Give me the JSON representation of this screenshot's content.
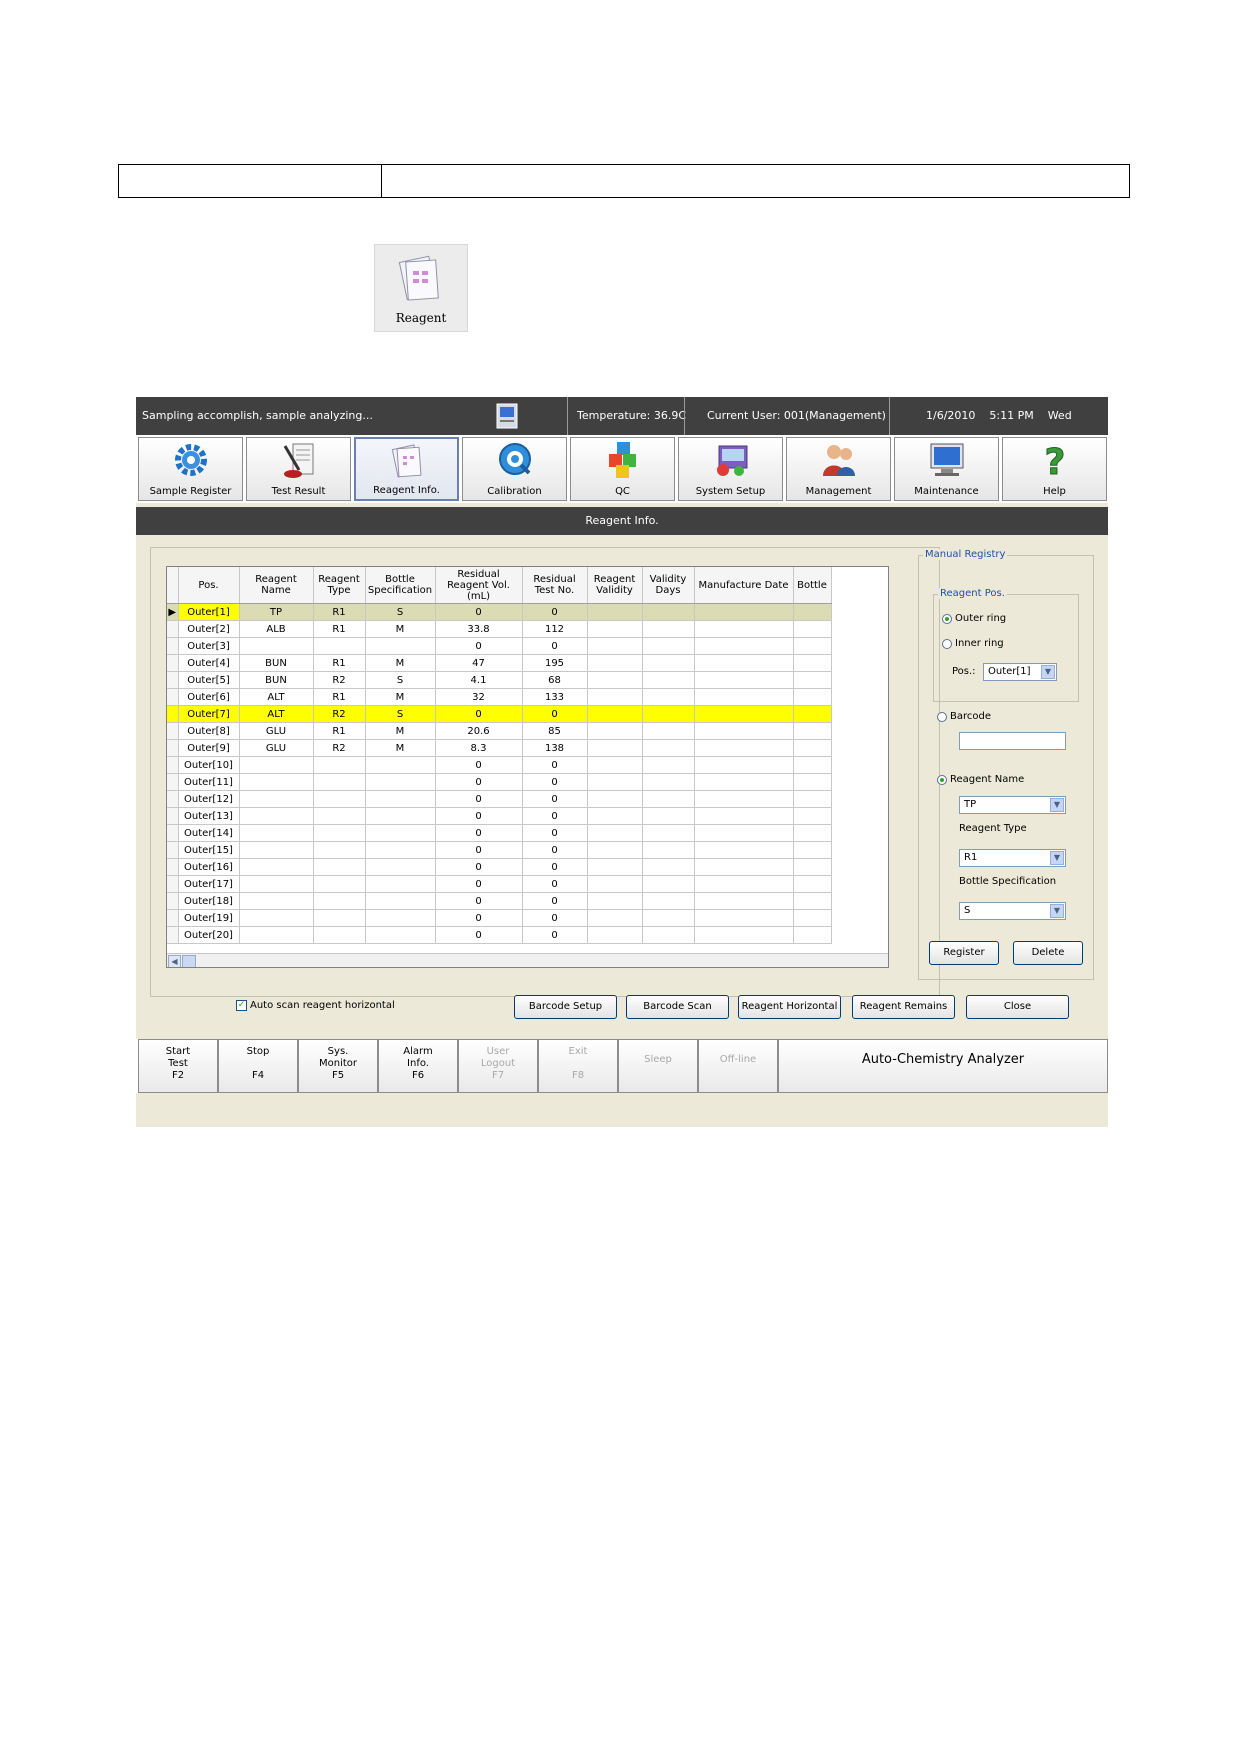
{
  "reagent_icon_label": "Reagent",
  "status": {
    "message": "Sampling accomplish, sample analyzing...",
    "temperature": "Temperature:  36.9C",
    "current_user": "Current User:  001(Management)",
    "datetime": "1/6/2010    5:11 PM    Wed"
  },
  "nav": [
    {
      "label": "Sample Register",
      "icon": "gear-icon"
    },
    {
      "label": "Test Result",
      "icon": "test-result-icon"
    },
    {
      "label": "Reagent Info.",
      "icon": "reagent-icon"
    },
    {
      "label": "Calibration",
      "icon": "calibration-icon"
    },
    {
      "label": "QC",
      "icon": "qc-cubes-icon"
    },
    {
      "label": "System Setup",
      "icon": "system-setup-icon"
    },
    {
      "label": "Management",
      "icon": "management-users-icon"
    },
    {
      "label": "Maintenance",
      "icon": "monitor-icon"
    },
    {
      "label": "Help",
      "icon": "help-question-icon"
    }
  ],
  "page_title": "Reagent Info.",
  "table": {
    "headers": [
      "Pos.",
      "Reagent Name",
      "Reagent Type",
      "Bottle Specification",
      "Residual Reagent Vol.(mL)",
      "Residual Test No.",
      "Reagent Validity",
      "Validity Days",
      "Manufacture Date",
      "Bottle"
    ],
    "rows": [
      [
        "Outer[1]",
        "TP",
        "R1",
        "S",
        "0",
        "0",
        "",
        "",
        "",
        ""
      ],
      [
        "Outer[2]",
        "ALB",
        "R1",
        "M",
        "33.8",
        "112",
        "",
        "",
        "",
        ""
      ],
      [
        "Outer[3]",
        "",
        "",
        "",
        "0",
        "0",
        "",
        "",
        "",
        ""
      ],
      [
        "Outer[4]",
        "BUN",
        "R1",
        "M",
        "47",
        "195",
        "",
        "",
        "",
        ""
      ],
      [
        "Outer[5]",
        "BUN",
        "R2",
        "S",
        "4.1",
        "68",
        "",
        "",
        "",
        ""
      ],
      [
        "Outer[6]",
        "ALT",
        "R1",
        "M",
        "32",
        "133",
        "",
        "",
        "",
        ""
      ],
      [
        "Outer[7]",
        "ALT",
        "R2",
        "S",
        "0",
        "0",
        "",
        "",
        "",
        ""
      ],
      [
        "Outer[8]",
        "GLU",
        "R1",
        "M",
        "20.6",
        "85",
        "",
        "",
        "",
        ""
      ],
      [
        "Outer[9]",
        "GLU",
        "R2",
        "M",
        "8.3",
        "138",
        "",
        "",
        "",
        ""
      ],
      [
        "Outer[10]",
        "",
        "",
        "",
        "0",
        "0",
        "",
        "",
        "",
        ""
      ],
      [
        "Outer[11]",
        "",
        "",
        "",
        "0",
        "0",
        "",
        "",
        "",
        ""
      ],
      [
        "Outer[12]",
        "",
        "",
        "",
        "0",
        "0",
        "",
        "",
        "",
        ""
      ],
      [
        "Outer[13]",
        "",
        "",
        "",
        "0",
        "0",
        "",
        "",
        "",
        ""
      ],
      [
        "Outer[14]",
        "",
        "",
        "",
        "0",
        "0",
        "",
        "",
        "",
        ""
      ],
      [
        "Outer[15]",
        "",
        "",
        "",
        "0",
        "0",
        "",
        "",
        "",
        ""
      ],
      [
        "Outer[16]",
        "",
        "",
        "",
        "0",
        "0",
        "",
        "",
        "",
        ""
      ],
      [
        "Outer[17]",
        "",
        "",
        "",
        "0",
        "0",
        "",
        "",
        "",
        ""
      ],
      [
        "Outer[18]",
        "",
        "",
        "",
        "0",
        "0",
        "",
        "",
        "",
        ""
      ],
      [
        "Outer[19]",
        "",
        "",
        "",
        "0",
        "0",
        "",
        "",
        "",
        ""
      ],
      [
        "Outer[20]",
        "",
        "",
        "",
        "0",
        "0",
        "",
        "",
        "",
        ""
      ]
    ]
  },
  "manual": {
    "legend": "Manual Registry",
    "reagent_pos_legend": "Reagent Pos.",
    "outer_ring": "Outer ring",
    "inner_ring": "Inner ring",
    "pos_label": "Pos.:",
    "pos_value": "Outer[1]",
    "barcode": "Barcode",
    "reagent_name": "Reagent Name",
    "reagent_name_value": "TP",
    "reagent_type_label": "Reagent Type",
    "reagent_type_value": "R1",
    "bottle_spec_label": "Bottle Specification",
    "bottle_spec_value": "S",
    "register": "Register",
    "delete": "Delete"
  },
  "auto_scan_label": "Auto scan reagent horizontal",
  "buttons": {
    "barcode_setup": "Barcode Setup",
    "barcode_scan": "Barcode Scan",
    "reagent_horizontal": "Reagent Horizontal",
    "reagent_remains": "Reagent Remains",
    "close": "Close"
  },
  "fkeys": [
    {
      "l1": "Start",
      "l2": "Test",
      "l3": "F2",
      "enabled": true
    },
    {
      "l1": "Stop",
      "l2": "",
      "l3": "F4",
      "enabled": true
    },
    {
      "l1": "Sys.",
      "l2": "Monitor",
      "l3": "F5",
      "enabled": true
    },
    {
      "l1": "Alarm",
      "l2": "Info.",
      "l3": "F6",
      "enabled": true
    },
    {
      "l1": "User",
      "l2": "Logout",
      "l3": "F7",
      "enabled": false
    },
    {
      "l1": "Exit",
      "l2": "",
      "l3": "F8",
      "enabled": false
    },
    {
      "l1": "Sleep",
      "l2": "",
      "l3": "",
      "enabled": false
    },
    {
      "l1": "Off-line",
      "l2": "",
      "l3": "",
      "enabled": false
    }
  ],
  "product_name": "Auto-Chemistry Analyzer",
  "colors": {
    "selected_row": "#dcdcb4",
    "highlight_row": "#ffff00",
    "header_bar": "#404040"
  }
}
